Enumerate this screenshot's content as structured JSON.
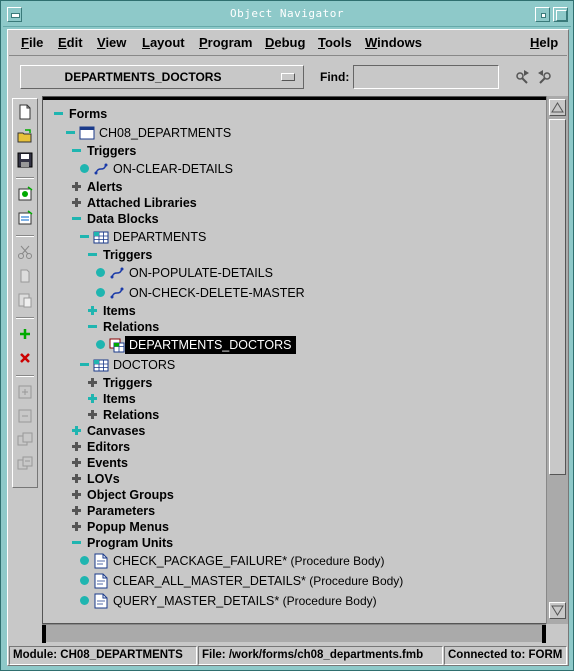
{
  "window": {
    "title": "Object Navigator"
  },
  "menubar": {
    "items": [
      {
        "label": "File",
        "u": "F",
        "rest": "ile"
      },
      {
        "label": "Edit",
        "u": "E",
        "rest": "dit"
      },
      {
        "label": "View",
        "u": "V",
        "rest": "iew"
      },
      {
        "label": "Layout",
        "u": "L",
        "rest": "ayout"
      },
      {
        "label": "Program",
        "u": "P",
        "rest": "rogram"
      },
      {
        "label": "Debug",
        "u": "D",
        "rest": "ebug"
      },
      {
        "label": "Tools",
        "u": "T",
        "rest": "ools"
      },
      {
        "label": "Windows",
        "u": "W",
        "rest": "indows"
      },
      {
        "label": "Help",
        "u": "H",
        "rest": "elp"
      }
    ]
  },
  "toolbar": {
    "context_value": "DEPARTMENTS_DOCTORS",
    "find_label": "Find:",
    "find_value": ""
  },
  "tree": {
    "nodes": [
      {
        "label": "Forms",
        "toggle": "minus",
        "icon": null,
        "bold": true
      },
      {
        "label": "CH08_DEPARTMENTS",
        "toggle": "minus",
        "icon": "form-icon",
        "bold": false
      },
      {
        "label": "Triggers",
        "toggle": "minus",
        "icon": null,
        "bold": true
      },
      {
        "label": "ON-CLEAR-DETAILS",
        "toggle": "dot",
        "icon": "trigger-icon",
        "bold": false
      },
      {
        "label": "Alerts",
        "toggle": "plus-grey",
        "icon": null,
        "bold": true
      },
      {
        "label": "Attached Libraries",
        "toggle": "plus-grey",
        "icon": null,
        "bold": true
      },
      {
        "label": "Data Blocks",
        "toggle": "minus",
        "icon": null,
        "bold": true
      },
      {
        "label": "DEPARTMENTS",
        "toggle": "minus",
        "icon": "data-block-icon",
        "bold": false
      },
      {
        "label": "Triggers",
        "toggle": "minus",
        "icon": null,
        "bold": true
      },
      {
        "label": "ON-POPULATE-DETAILS",
        "toggle": "dot",
        "icon": "trigger-icon",
        "bold": false
      },
      {
        "label": "ON-CHECK-DELETE-MASTER",
        "toggle": "dot",
        "icon": "trigger-icon",
        "bold": false
      },
      {
        "label": "Items",
        "toggle": "plus-teal",
        "icon": null,
        "bold": true
      },
      {
        "label": "Relations",
        "toggle": "minus",
        "icon": null,
        "bold": true
      },
      {
        "label": "DEPARTMENTS_DOCTORS",
        "toggle": "dot",
        "icon": "relation-icon",
        "bold": false,
        "selected": true
      },
      {
        "label": "DOCTORS",
        "toggle": "minus",
        "icon": "data-block-icon",
        "bold": false
      },
      {
        "label": "Triggers",
        "toggle": "plus-grey",
        "icon": null,
        "bold": true
      },
      {
        "label": "Items",
        "toggle": "plus-teal",
        "icon": null,
        "bold": true
      },
      {
        "label": "Relations",
        "toggle": "plus-grey",
        "icon": null,
        "bold": true
      },
      {
        "label": "Canvases",
        "toggle": "plus-teal",
        "icon": null,
        "bold": true
      },
      {
        "label": "Editors",
        "toggle": "plus-grey",
        "icon": null,
        "bold": true
      },
      {
        "label": "Events",
        "toggle": "plus-grey",
        "icon": null,
        "bold": true
      },
      {
        "label": "LOVs",
        "toggle": "plus-grey",
        "icon": null,
        "bold": true
      },
      {
        "label": "Object Groups",
        "toggle": "plus-grey",
        "icon": null,
        "bold": true
      },
      {
        "label": "Parameters",
        "toggle": "plus-grey",
        "icon": null,
        "bold": true
      },
      {
        "label": "Popup Menus",
        "toggle": "plus-grey",
        "icon": null,
        "bold": true
      },
      {
        "label": "Program Units",
        "toggle": "minus",
        "icon": null,
        "bold": true
      },
      {
        "label": "CHECK_PACKAGE_FAILURE*",
        "sub": " (Procedure Body)",
        "toggle": "dot",
        "icon": "procedure-icon",
        "bold": false
      },
      {
        "label": "CLEAR_ALL_MASTER_DETAILS*",
        "sub": " (Procedure Body)",
        "toggle": "dot",
        "icon": "procedure-icon",
        "bold": false
      },
      {
        "label": "QUERY_MASTER_DETAILS*",
        "sub": " (Procedure Body)",
        "toggle": "dot",
        "icon": "procedure-icon",
        "bold": false
      }
    ]
  },
  "statusbar": {
    "module": "Module: CH08_DEPARTMENTS",
    "file": "File: /work/forms/ch08_departments.fmb",
    "connection": "Connected to: FORM"
  },
  "colors": {
    "title_bg": "#8ec9c9",
    "panel_bg": "#c8c8c8",
    "toggle_teal": "#1fb5b0",
    "selection_bg": "#000000"
  }
}
